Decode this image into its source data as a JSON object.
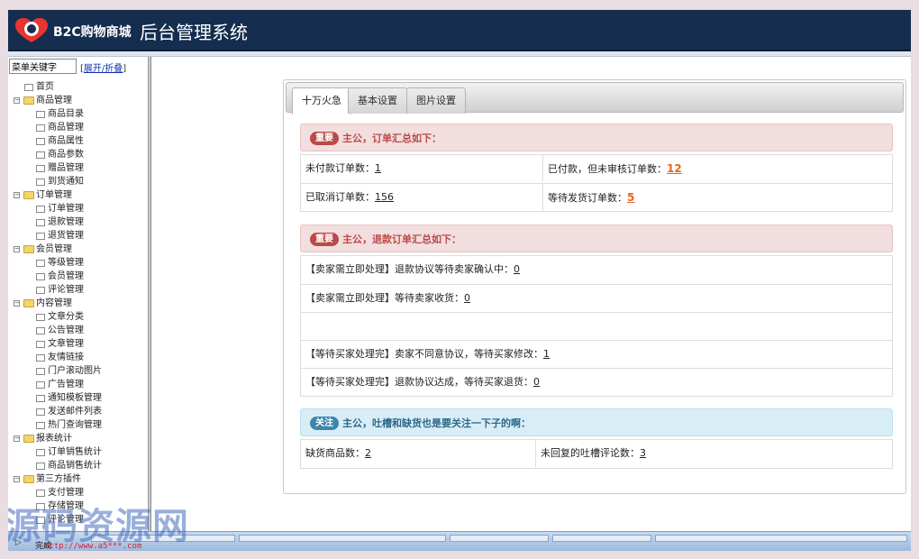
{
  "header": {
    "brand": "B2C购物商城",
    "title": "后台管理系统"
  },
  "sidebar": {
    "search_value": "菜单关键字",
    "toggle_open_bracket": "[",
    "toggle_label": "展开/折叠",
    "toggle_close_bracket": "]",
    "tree": [
      {
        "label": "首页",
        "level": 0,
        "type": "doc"
      },
      {
        "label": "商品管理",
        "level": 0,
        "type": "folder"
      },
      {
        "label": "商品目录",
        "level": 1
      },
      {
        "label": "商品管理",
        "level": 1
      },
      {
        "label": "商品属性",
        "level": 1
      },
      {
        "label": "商品参数",
        "level": 1
      },
      {
        "label": "赠品管理",
        "level": 1
      },
      {
        "label": "到货通知",
        "level": 1
      },
      {
        "label": "订单管理",
        "level": 0,
        "type": "folder"
      },
      {
        "label": "订单管理",
        "level": 1
      },
      {
        "label": "退款管理",
        "level": 1
      },
      {
        "label": "退货管理",
        "level": 1
      },
      {
        "label": "会员管理",
        "level": 0,
        "type": "folder"
      },
      {
        "label": "等级管理",
        "level": 1
      },
      {
        "label": "会员管理",
        "level": 1
      },
      {
        "label": "评论管理",
        "level": 1
      },
      {
        "label": "内容管理",
        "level": 0,
        "type": "folder"
      },
      {
        "label": "文章分类",
        "level": 1
      },
      {
        "label": "公告管理",
        "level": 1
      },
      {
        "label": "文章管理",
        "level": 1
      },
      {
        "label": "友情链接",
        "level": 1
      },
      {
        "label": "门户滚动图片",
        "level": 1
      },
      {
        "label": "广告管理",
        "level": 1
      },
      {
        "label": "通知模板管理",
        "level": 1
      },
      {
        "label": "发送邮件列表",
        "level": 1
      },
      {
        "label": "热门查询管理",
        "level": 1
      },
      {
        "label": "报表统计",
        "level": 0,
        "type": "folder"
      },
      {
        "label": "订单销售统计",
        "level": 1
      },
      {
        "label": "商品销售统计",
        "level": 1
      },
      {
        "label": "第三方插件",
        "level": 0,
        "type": "folder"
      },
      {
        "label": "支付管理",
        "level": 1
      },
      {
        "label": "存储管理",
        "level": 1
      },
      {
        "label": "评论管理",
        "level": 1
      }
    ]
  },
  "tabs": [
    {
      "label": "十万火急",
      "active": true
    },
    {
      "label": "基本设置",
      "active": false
    },
    {
      "label": "图片设置",
      "active": false
    }
  ],
  "orders": {
    "badge": "重要",
    "heading": "主公，订单汇总如下：",
    "unpaid_label": "未付款订单数：",
    "unpaid_value": "1",
    "paid_unreviewed_label": "已付款，但未审核订单数：",
    "paid_unreviewed_value": "12",
    "cancelled_label": "已取消订单数：",
    "cancelled_value": "156",
    "awaiting_ship_label": "等待发货订单数：",
    "awaiting_ship_value": "5"
  },
  "refunds": {
    "badge": "重要",
    "heading": "主公，退款订单汇总如下：",
    "rows": [
      {
        "label": "【卖家需立即处理】退款协议等待卖家确认中：",
        "value": "0"
      },
      {
        "label": "【卖家需立即处理】等待卖家收货：",
        "value": "0"
      },
      {
        "label": "",
        "value": ""
      },
      {
        "label": "【等待买家处理完】卖家不同意协议，等待买家修改：",
        "value": "1"
      },
      {
        "label": "【等待买家处理完】退款协议达成，等待买家退货：",
        "value": "0"
      }
    ]
  },
  "stock": {
    "badge": "关注",
    "heading": "主公，吐槽和缺货也是要关注一下子的啊：",
    "out_of_stock_label": "缺货商品数：",
    "out_of_stock_value": "2",
    "unreplied_label": "未回复的吐槽评论数：",
    "unreplied_value": "3"
  },
  "statusbar": {
    "text": "完成",
    "url": "http://www.a5***.com"
  },
  "watermark": "源码资源网",
  "colors": {
    "header_bg": "#152d4f",
    "danger_bg": "#f2dede",
    "danger_text": "#b94a48",
    "info_bg": "#d9edf7",
    "info_badge": "#3a87ad",
    "hot_number": "#e8641b"
  }
}
